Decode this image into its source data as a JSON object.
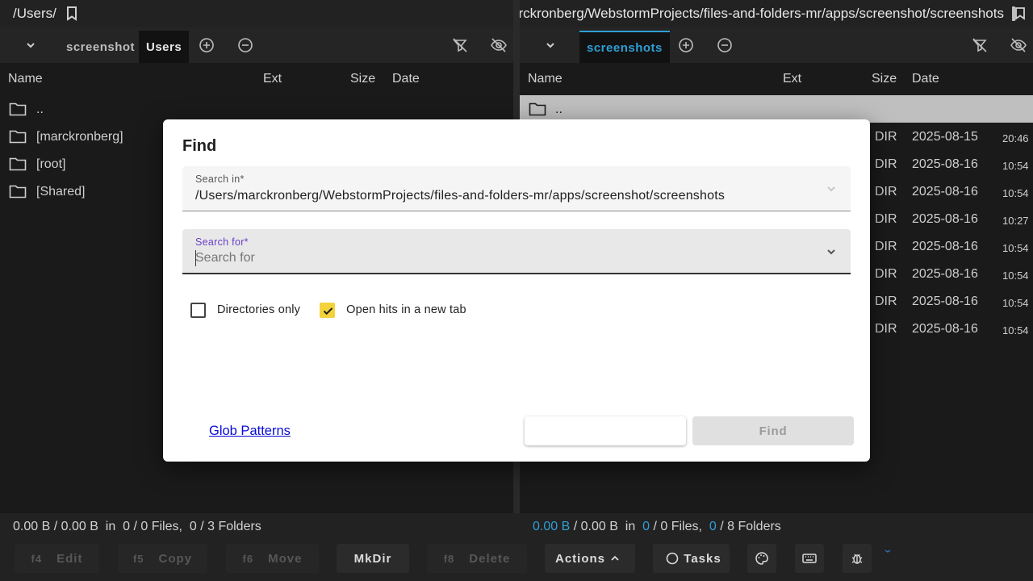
{
  "left_pane": {
    "path": "/Users/",
    "tabs": [
      {
        "label": "screenshot"
      },
      {
        "label": "Users"
      }
    ],
    "columns": {
      "name": "Name",
      "ext": "Ext",
      "size": "Size",
      "date": "Date"
    },
    "rows": [
      {
        "name": ".."
      },
      {
        "name": "[marckronberg]"
      },
      {
        "name": "[root]"
      },
      {
        "name": "[Shared]"
      }
    ],
    "status": {
      "sel_size": "0.00 B",
      "total_size": "0.00 B",
      "in": "in",
      "files_sel": "0",
      "files_total": "0",
      "files_label": "Files,",
      "folders_sel": "0",
      "folders_total": "3",
      "folders_label": "Folders"
    }
  },
  "right_pane": {
    "path": "arckronberg/WebstormProjects/files-and-folders-mr/apps/screenshot/screenshots/",
    "tabs": [
      {
        "label": "screenshots"
      }
    ],
    "columns": {
      "name": "Name",
      "ext": "Ext",
      "size": "Size",
      "date": "Date"
    },
    "rows": [
      {
        "name": "..",
        "type": "",
        "date": "",
        "time": ""
      },
      {
        "name": "",
        "type": "DIR",
        "date": "2025-08-15",
        "time": "20:46"
      },
      {
        "name": "",
        "type": "DIR",
        "date": "2025-08-16",
        "time": "10:54"
      },
      {
        "name": "",
        "type": "DIR",
        "date": "2025-08-16",
        "time": "10:54"
      },
      {
        "name": "",
        "type": "DIR",
        "date": "2025-08-16",
        "time": "10:27"
      },
      {
        "name": "",
        "type": "DIR",
        "date": "2025-08-16",
        "time": "10:54"
      },
      {
        "name": "",
        "type": "DIR",
        "date": "2025-08-16",
        "time": "10:54"
      },
      {
        "name": "",
        "type": "DIR",
        "date": "2025-08-16",
        "time": "10:54"
      },
      {
        "name": "",
        "type": "DIR",
        "date": "2025-08-16",
        "time": "10:54"
      }
    ],
    "status": {
      "sel_size": "0.00 B",
      "total_size": "0.00 B",
      "in": "in",
      "files_sel": "0",
      "files_total": "0",
      "files_label": "Files,",
      "folders_sel": "0",
      "folders_total": "8",
      "folders_label": "Folders"
    }
  },
  "toolbar": {
    "edit": {
      "key": "f4",
      "label": "Edit"
    },
    "copy": {
      "key": "f5",
      "label": "Copy"
    },
    "move": {
      "key": "f6",
      "label": "Move"
    },
    "mkdir": {
      "label": "MkDir"
    },
    "delete": {
      "key": "f8",
      "label": "Delete"
    },
    "actions": {
      "label": "Actions"
    },
    "tasks": {
      "label": "Tasks"
    },
    "icons": [
      "palette-icon",
      "keyboard-icon",
      "bug-icon"
    ]
  },
  "dialog": {
    "title": "Find",
    "search_in": {
      "label": "Search in*",
      "value": "/Users/marckronberg/WebstormProjects/files-and-folders-mr/apps/screenshot/screenshots"
    },
    "search_for": {
      "label": "Search for*",
      "placeholder": "Search for",
      "value": ""
    },
    "directories_only": {
      "label": "Directories only",
      "checked": false
    },
    "open_new_tab": {
      "label": "Open hits in a new tab",
      "checked": true
    },
    "glob_link": "Glob Patterns",
    "cancel_label": "",
    "find_label": "Find"
  },
  "colors": {
    "accent_blue": "#2f9fd6",
    "checkbox_yellow": "#f3d23b",
    "link": "#0a0ad6",
    "focus_label": "#6a3fc7"
  }
}
